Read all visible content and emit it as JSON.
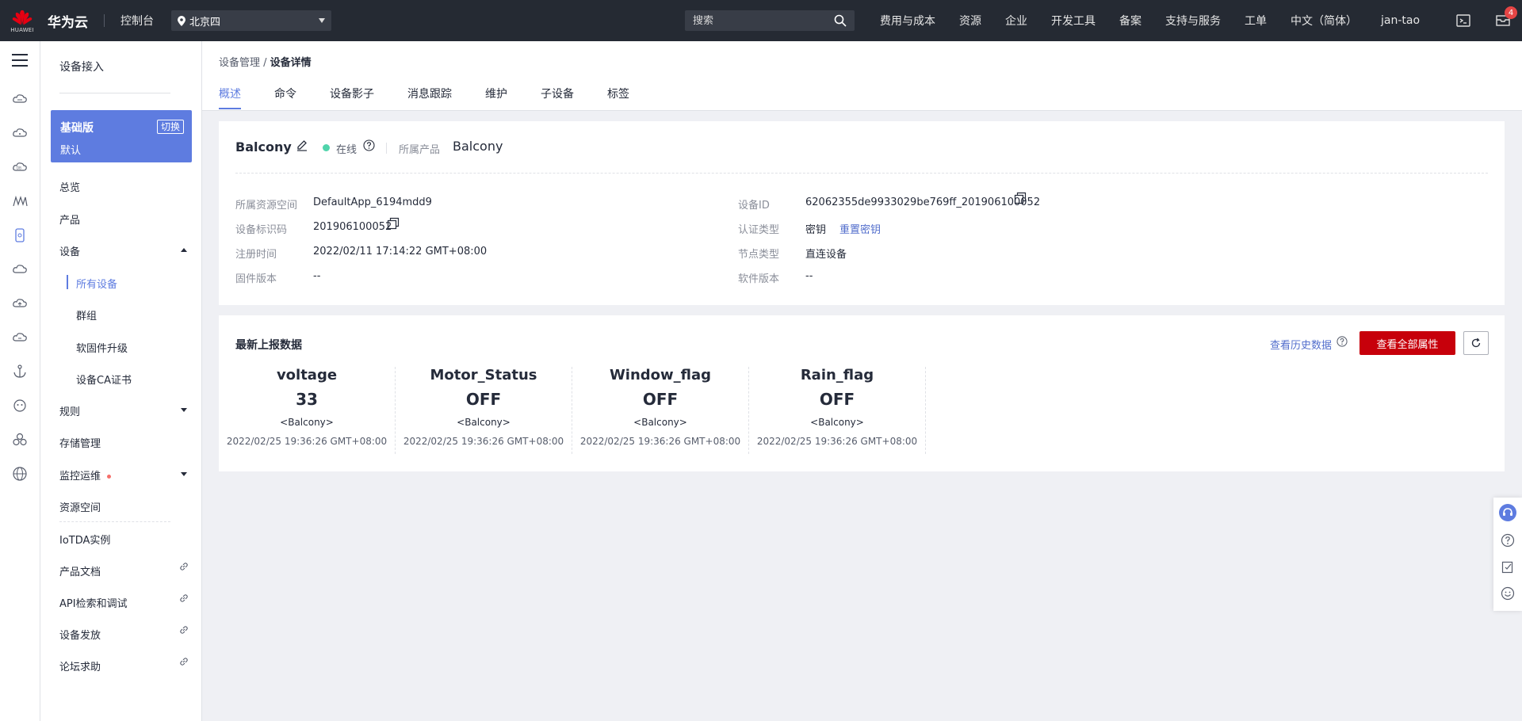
{
  "topbar": {
    "logo_text": "HUAWEI",
    "brand": "华为云",
    "console": "控制台",
    "region": "北京四",
    "search_placeholder": "搜索",
    "nav": [
      "费用与成本",
      "资源",
      "企业",
      "开发工具",
      "备案",
      "支持与服务",
      "工单",
      "中文（简体）",
      "jan-tao"
    ],
    "message_count": "4"
  },
  "sidebar": {
    "title": "设备接入",
    "edition": {
      "name": "基础版",
      "switch": "切换",
      "sub": "默认"
    },
    "items": {
      "overview": "总览",
      "product": "产品",
      "device": "设备",
      "all_devices": "所有设备",
      "group": "群组",
      "firmware": "软固件升级",
      "ca": "设备CA证书",
      "rules": "规则",
      "storage": "存储管理",
      "monitor": "监控运维",
      "resource_space": "资源空间",
      "instance": "IoTDA实例",
      "docs": "产品文档",
      "api": "API检索和调试",
      "provision": "设备发放",
      "forum": "论坛求助"
    }
  },
  "breadcrumb": {
    "parent": "设备管理",
    "separator": " / ",
    "current": "设备详情"
  },
  "tabs": [
    "概述",
    "命令",
    "设备影子",
    "消息跟踪",
    "维护",
    "子设备",
    "标签"
  ],
  "device": {
    "name": "Balcony",
    "status": "在线",
    "product_label": "所属产品",
    "product": "Balcony",
    "fields": {
      "resource_space_label": "所属资源空间",
      "resource_space": "DefaultApp_6194mdd9",
      "node_id_label": "设备标识码",
      "node_id": "201906100052",
      "register_time_label": "注册时间",
      "register_time": "2022/02/11 17:14:22 GMT+08:00",
      "firmware_label": "固件版本",
      "firmware": "--",
      "device_id_label": "设备ID",
      "device_id": "62062355de9933029be769ff_201906100052",
      "auth_type_label": "认证类型",
      "auth_type": "密钥",
      "reset_secret": "重置密钥",
      "node_type_label": "节点类型",
      "node_type": "直连设备",
      "software_label": "软件版本",
      "software": "--"
    }
  },
  "latest": {
    "title": "最新上报数据",
    "history_link": "查看历史数据",
    "all_props_button": "查看全部属性",
    "properties": [
      {
        "name": "voltage",
        "value": "33",
        "device": "<Balcony>",
        "time": "2022/02/25 19:36:26 GMT+08:00"
      },
      {
        "name": "Motor_Status",
        "value": "OFF",
        "device": "<Balcony>",
        "time": "2022/02/25 19:36:26 GMT+08:00"
      },
      {
        "name": "Window_flag",
        "value": "OFF",
        "device": "<Balcony>",
        "time": "2022/02/25 19:36:26 GMT+08:00"
      },
      {
        "name": "Rain_flag",
        "value": "OFF",
        "device": "<Balcony>",
        "time": "2022/02/25 19:36:26 GMT+08:00"
      }
    ]
  },
  "colors": {
    "accent": "#5e7ce0",
    "brand_red": "#c7000b",
    "online": "#50d4ab",
    "topbar": "#252a33"
  }
}
